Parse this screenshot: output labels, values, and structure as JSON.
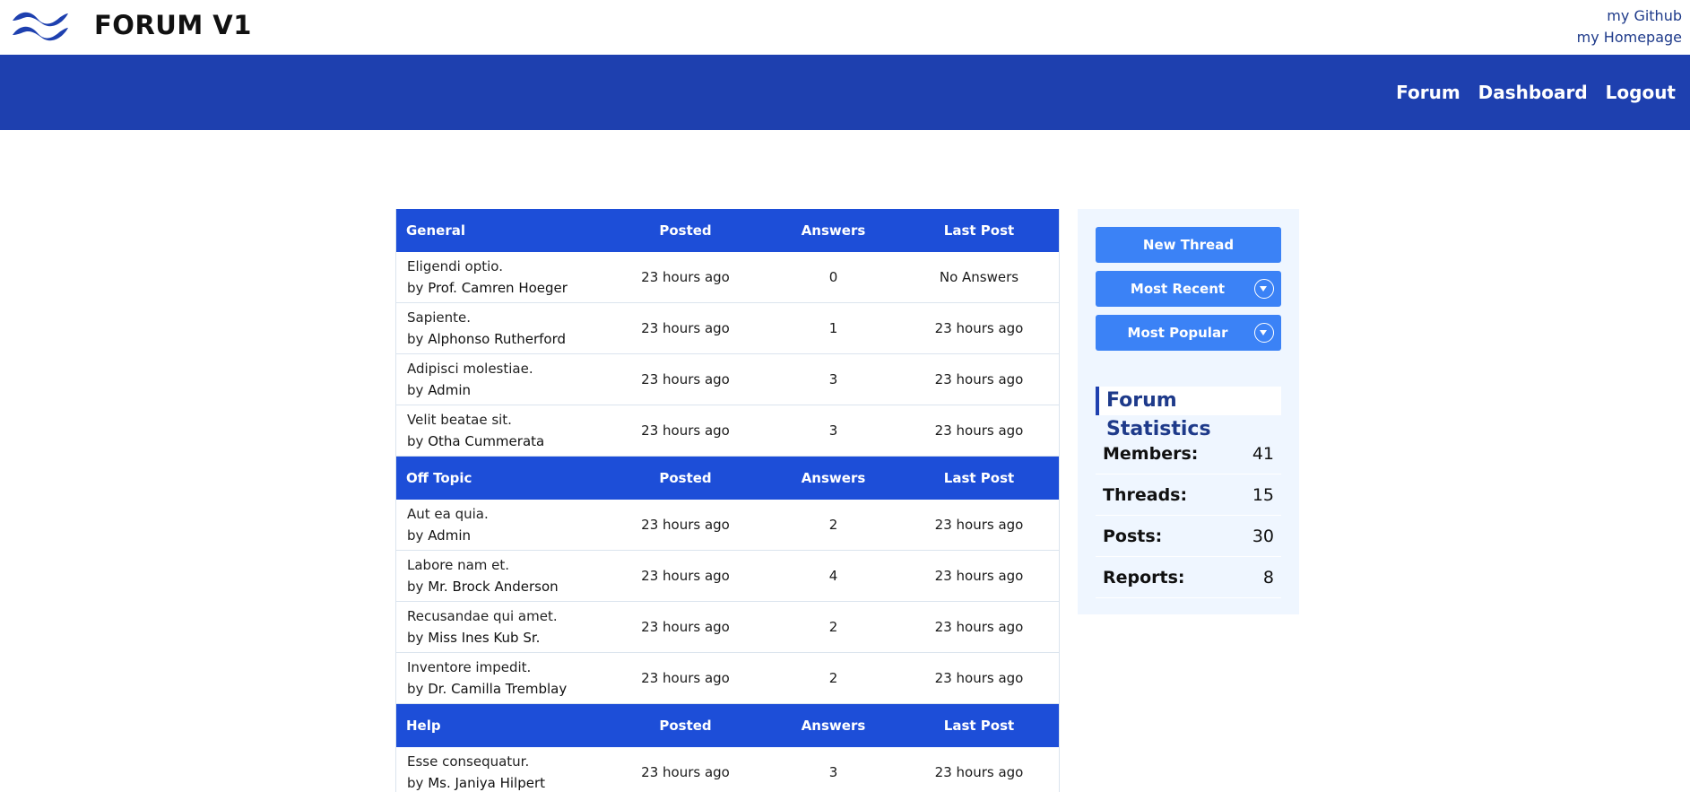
{
  "header": {
    "site_title": "FORUM V1",
    "logo_icon": "tailwind-wave-icon",
    "links": [
      "my Github",
      "my Homepage"
    ]
  },
  "nav": {
    "items": [
      "Forum",
      "Dashboard",
      "Logout"
    ]
  },
  "columns": {
    "posted": "Posted",
    "answers": "Answers",
    "last_post": "Last Post"
  },
  "sections": [
    {
      "name": "General",
      "threads": [
        {
          "title": "Eligendi optio.",
          "by": "by",
          "author": "Prof. Camren Hoeger",
          "posted": "23 hours ago",
          "answers": "0",
          "last_post": "No Answers"
        },
        {
          "title": "Sapiente.",
          "by": "by",
          "author": "Alphonso Rutherford",
          "posted": "23 hours ago",
          "answers": "1",
          "last_post": "23 hours ago"
        },
        {
          "title": "Adipisci molestiae.",
          "by": "by",
          "author": "Admin",
          "posted": "23 hours ago",
          "answers": "3",
          "last_post": "23 hours ago"
        },
        {
          "title": "Velit beatae sit.",
          "by": "by",
          "author": "Otha Cummerata",
          "posted": "23 hours ago",
          "answers": "3",
          "last_post": "23 hours ago"
        }
      ]
    },
    {
      "name": "Off Topic",
      "threads": [
        {
          "title": "Aut ea quia.",
          "by": "by",
          "author": "Admin",
          "posted": "23 hours ago",
          "answers": "2",
          "last_post": "23 hours ago"
        },
        {
          "title": "Labore nam et.",
          "by": "by",
          "author": "Mr. Brock Anderson",
          "posted": "23 hours ago",
          "answers": "4",
          "last_post": "23 hours ago"
        },
        {
          "title": "Recusandae qui amet.",
          "by": "by",
          "author": "Miss Ines Kub Sr.",
          "posted": "23 hours ago",
          "answers": "2",
          "last_post": "23 hours ago"
        },
        {
          "title": "Inventore impedit.",
          "by": "by",
          "author": "Dr. Camilla Tremblay",
          "posted": "23 hours ago",
          "answers": "2",
          "last_post": "23 hours ago"
        }
      ]
    },
    {
      "name": "Help",
      "threads": [
        {
          "title": "Esse consequatur.",
          "by": "by",
          "author": "Ms. Janiya Hilpert",
          "posted": "23 hours ago",
          "answers": "3",
          "last_post": "23 hours ago"
        }
      ]
    }
  ],
  "sidebar": {
    "new_thread": "New Thread",
    "most_recent": "Most Recent",
    "most_popular": "Most Popular",
    "stats_title": "Forum Statistics",
    "stats": [
      {
        "label": "Members:",
        "value": "41"
      },
      {
        "label": "Threads:",
        "value": "15"
      },
      {
        "label": "Posts:",
        "value": "30"
      },
      {
        "label": "Reports:",
        "value": "8"
      }
    ]
  },
  "colors": {
    "navbar": "#1e40af",
    "section_header": "#1d4ed8",
    "sidebar_button": "#3b82f6",
    "sidebar_bg": "#eff6ff"
  }
}
